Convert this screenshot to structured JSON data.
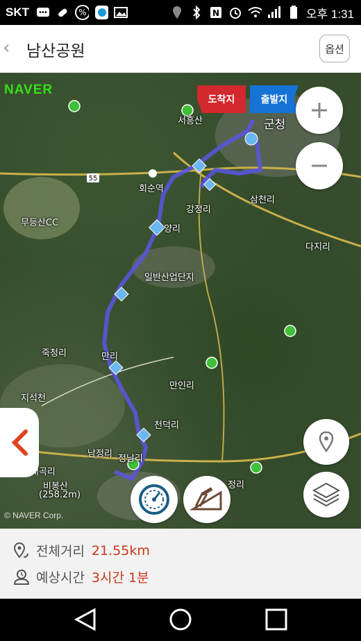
{
  "status_bar": {
    "carrier": "SKT",
    "time": "오후 1:31"
  },
  "header": {
    "back_icon": "chevron-left-icon",
    "title": "남산공원",
    "option_label": "옵션"
  },
  "map": {
    "logo": "NAVER",
    "copyright": "© NAVER Corp.",
    "start_flag": "출발지",
    "end_flag": "도착지",
    "route_color": "#5a55d8",
    "labels": [
      {
        "text": "서흥산"
      },
      {
        "text": "군청"
      },
      {
        "text": "회순역"
      },
      {
        "text": "무등산CC"
      },
      {
        "text": "강정리"
      },
      {
        "text": "양리"
      },
      {
        "text": "삼천리"
      },
      {
        "text": "다지리"
      },
      {
        "text": "일반산업단지"
      },
      {
        "text": "죽청리"
      },
      {
        "text": "지석천"
      },
      {
        "text": "만리"
      },
      {
        "text": "만인리"
      },
      {
        "text": "천덕리"
      },
      {
        "text": "남정리"
      },
      {
        "text": "정남리"
      },
      {
        "text": "대곡리"
      },
      {
        "text": "비봉산"
      },
      {
        "text": "(258.2m)"
      },
      {
        "text": "정리"
      },
      {
        "text": "55"
      }
    ]
  },
  "info": {
    "distance_label": "전체거리",
    "distance_value": "21.55km",
    "time_label": "예상시간",
    "time_value": "3시간 1분"
  }
}
